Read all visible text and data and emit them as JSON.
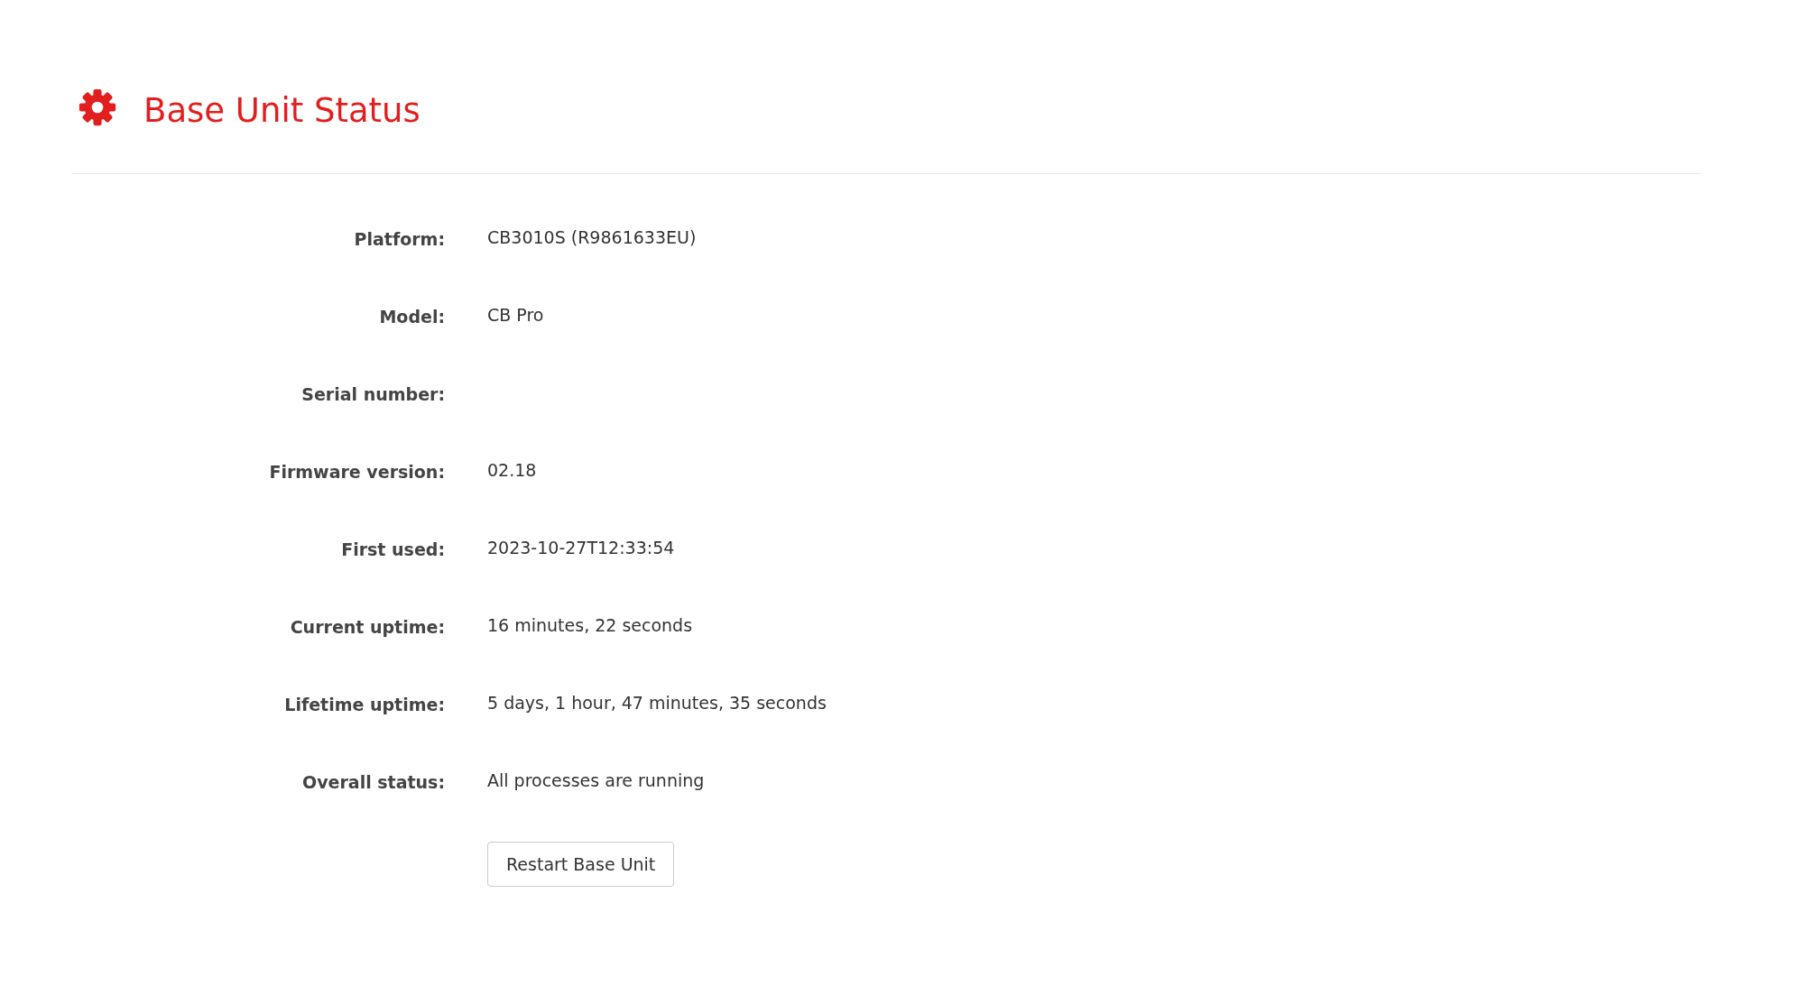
{
  "header": {
    "title": "Base Unit Status"
  },
  "fields": [
    {
      "label": "Platform:",
      "value": "CB3010S (R9861633EU)"
    },
    {
      "label": "Model:",
      "value": "CB Pro"
    },
    {
      "label": "Serial number:"
    },
    {
      "label": "Firmware version:",
      "value": "02.18"
    },
    {
      "label": "First used:",
      "value": "2023-10-27T12:33:54"
    },
    {
      "label": "Current uptime:",
      "value": "16 minutes, 22 seconds"
    },
    {
      "label": "Lifetime uptime:",
      "value": "5 days, 1 hour, 47 minutes, 35 seconds"
    },
    {
      "label": "Overall status:",
      "value": "All processes are running"
    }
  ],
  "button": "Restart Base Unit"
}
